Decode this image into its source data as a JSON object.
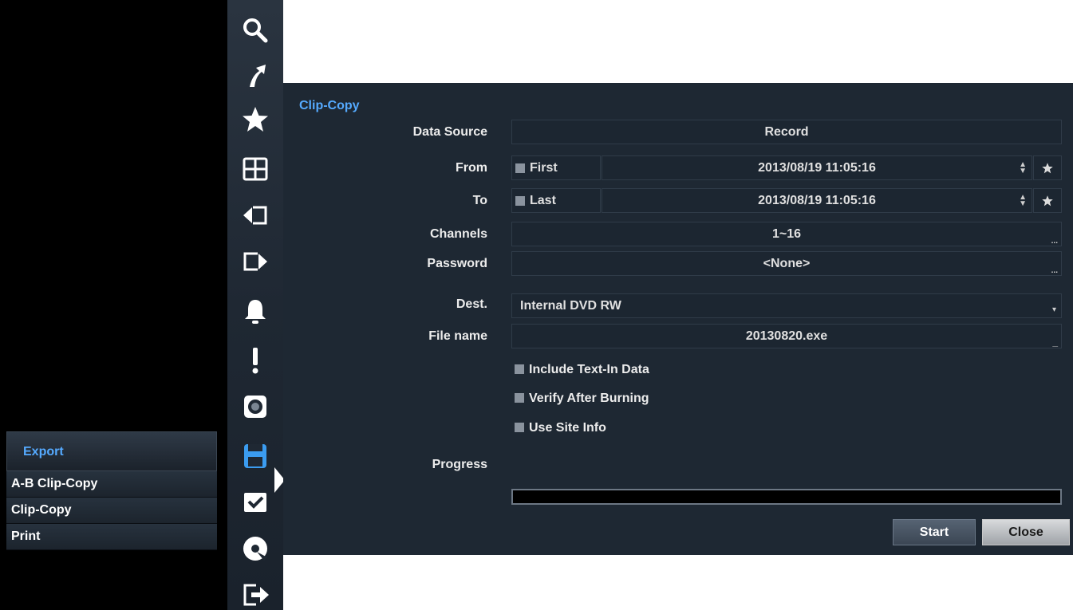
{
  "export_menu": {
    "header": "Export",
    "items": [
      "A-B Clip-Copy",
      "Clip-Copy",
      "Print"
    ]
  },
  "toolbar_icons": [
    "search-icon",
    "go-to-icon",
    "bookmark-star-icon",
    "layout-grid-icon",
    "previous-group-icon",
    "next-group-icon",
    "alarm-bell-icon",
    "event-alert-icon",
    "camera-icon",
    "export-save-icon",
    "checkbox-icon",
    "backup-disc-icon",
    "exit-icon"
  ],
  "dialog": {
    "title": "Clip-Copy",
    "data_source": {
      "label": "Data Source",
      "value": "Record"
    },
    "from": {
      "label": "From",
      "check_label": "First",
      "value": "2013/08/19  11:05:16"
    },
    "to": {
      "label": "To",
      "check_label": "Last",
      "value": "2013/08/19  11:05:16"
    },
    "channels": {
      "label": "Channels",
      "value": "1~16"
    },
    "password": {
      "label": "Password",
      "value": "<None>"
    },
    "dest": {
      "label": "Dest.",
      "value": "Internal DVD RW"
    },
    "file_name": {
      "label": "File name",
      "value": "20130820.exe"
    },
    "options": [
      "Include Text-In Data",
      "Verify After Burning",
      "Use Site Info"
    ],
    "progress": {
      "label": "Progress",
      "value": 0
    },
    "buttons": {
      "start": "Start",
      "close": "Close"
    }
  },
  "colors": {
    "accent": "#55aaff",
    "dialog_bg": "#1e2833"
  }
}
